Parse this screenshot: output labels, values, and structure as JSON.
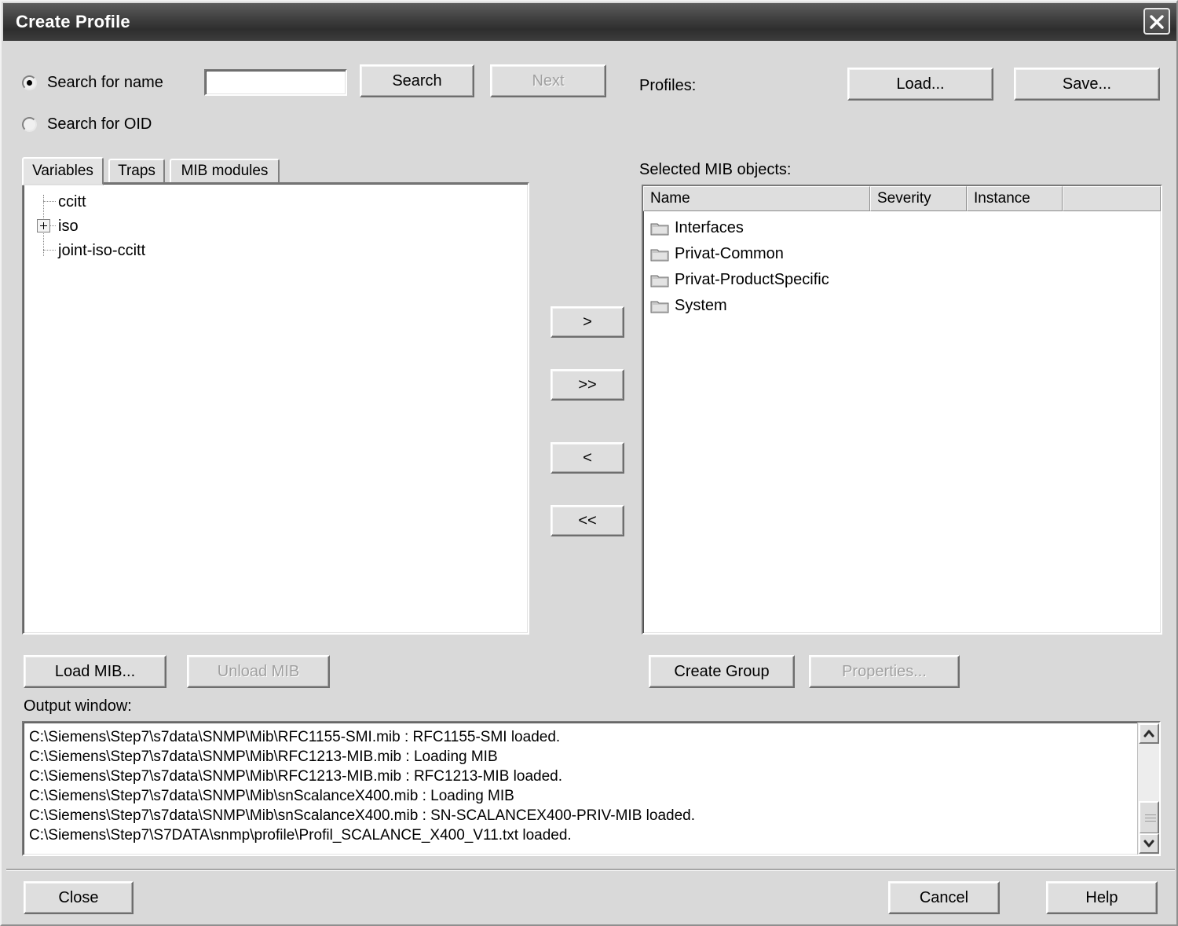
{
  "window": {
    "title": "Create Profile",
    "close_icon": "close-icon"
  },
  "search": {
    "radio_name_label": "Search for name",
    "radio_oid_label": "Search for OID",
    "input_value": "",
    "search_button": "Search",
    "next_button": "Next"
  },
  "profiles": {
    "label": "Profiles:",
    "load_button": "Load...",
    "save_button": "Save..."
  },
  "tabs": [
    {
      "label": "Variables",
      "active": true
    },
    {
      "label": "Traps",
      "active": false
    },
    {
      "label": "MIB modules",
      "active": false
    }
  ],
  "tree": {
    "items": [
      {
        "label": "ccitt",
        "expandable": false
      },
      {
        "label": "iso",
        "expandable": true
      },
      {
        "label": "joint-iso-ccitt",
        "expandable": false
      }
    ]
  },
  "mib_buttons": {
    "load_mib": "Load MIB...",
    "unload_mib": "Unload MIB"
  },
  "transfer": {
    "add": ">",
    "add_all": ">>",
    "remove": "<",
    "remove_all": "<<"
  },
  "selected": {
    "label": "Selected MIB objects:",
    "columns": [
      "Name",
      "Severity",
      "Instance",
      ""
    ],
    "rows": [
      {
        "name": "Interfaces",
        "severity": "",
        "instance": ""
      },
      {
        "name": "Privat-Common",
        "severity": "",
        "instance": ""
      },
      {
        "name": "Privat-ProductSpecific",
        "severity": "",
        "instance": ""
      },
      {
        "name": "System",
        "severity": "",
        "instance": ""
      }
    ],
    "create_group_button": "Create Group",
    "properties_button": "Properties..."
  },
  "output": {
    "label": "Output window:",
    "lines": [
      "C:\\Siemens\\Step7\\s7data\\SNMP\\Mib\\RFC1155-SMI.mib : RFC1155-SMI loaded.",
      "C:\\Siemens\\Step7\\s7data\\SNMP\\Mib\\RFC1213-MIB.mib : Loading MIB",
      "C:\\Siemens\\Step7\\s7data\\SNMP\\Mib\\RFC1213-MIB.mib : RFC1213-MIB loaded.",
      "C:\\Siemens\\Step7\\s7data\\SNMP\\Mib\\snScalanceX400.mib : Loading MIB",
      "C:\\Siemens\\Step7\\s7data\\SNMP\\Mib\\snScalanceX400.mib : SN-SCALANCEX400-PRIV-MIB loaded.",
      "C:\\Siemens\\Step7\\S7DATA\\snmp\\profile\\Profil_SCALANCE_X400_V11.txt loaded."
    ]
  },
  "footer": {
    "close_button": "Close",
    "cancel_button": "Cancel",
    "help_button": "Help"
  },
  "colors": {
    "dialog_face": "#d9d9d9",
    "titlebar_dark": "#3c3c3c",
    "control_face": "#dedede",
    "disabled_text": "#a0a0a0",
    "field_background": "#ffffff"
  }
}
